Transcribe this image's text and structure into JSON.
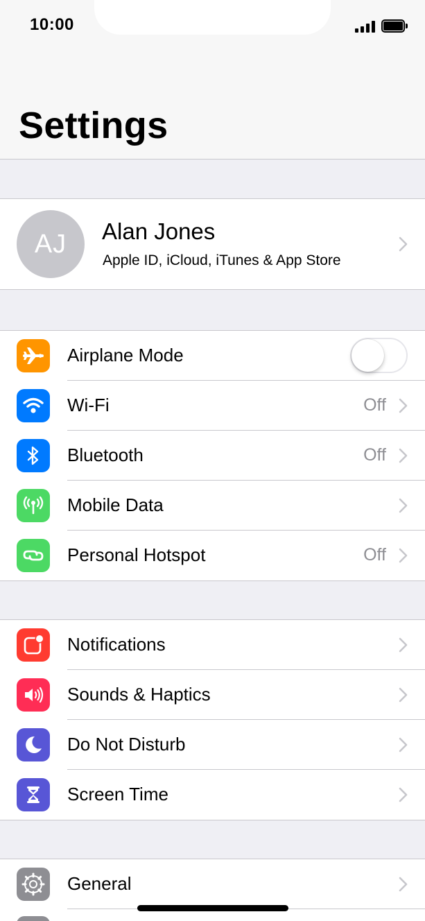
{
  "status_bar": {
    "time": "10:00"
  },
  "header": {
    "title": "Settings"
  },
  "profile": {
    "initials": "AJ",
    "name": "Alan Jones",
    "subtitle": "Apple ID, iCloud, iTunes & App Store"
  },
  "connectivity": [
    {
      "label": "Airplane Mode",
      "icon": "airplane-icon",
      "color": "#ff9500",
      "toggle_on": false
    },
    {
      "label": "Wi-Fi",
      "icon": "wifi-icon",
      "color": "#007aff",
      "value": "Off"
    },
    {
      "label": "Bluetooth",
      "icon": "bluetooth-icon",
      "color": "#007aff",
      "value": "Off"
    },
    {
      "label": "Mobile Data",
      "icon": "antenna-icon",
      "color": "#4cd964",
      "value": ""
    },
    {
      "label": "Personal Hotspot",
      "icon": "hotspot-icon",
      "color": "#4cd964",
      "value": "Off"
    }
  ],
  "alerts": [
    {
      "label": "Notifications",
      "icon": "notifications-icon",
      "color": "#ff3b30"
    },
    {
      "label": "Sounds & Haptics",
      "icon": "speaker-icon",
      "color": "#ff2d55"
    },
    {
      "label": "Do Not Disturb",
      "icon": "moon-icon",
      "color": "#5856d6"
    },
    {
      "label": "Screen Time",
      "icon": "hourglass-icon",
      "color": "#5856d6"
    }
  ],
  "system": [
    {
      "label": "General",
      "icon": "gear-icon",
      "color": "#8e8e93"
    }
  ],
  "colors": {
    "background": "#efeff4",
    "separator": "#c8c7cc",
    "secondary_text": "#8e8e93"
  }
}
